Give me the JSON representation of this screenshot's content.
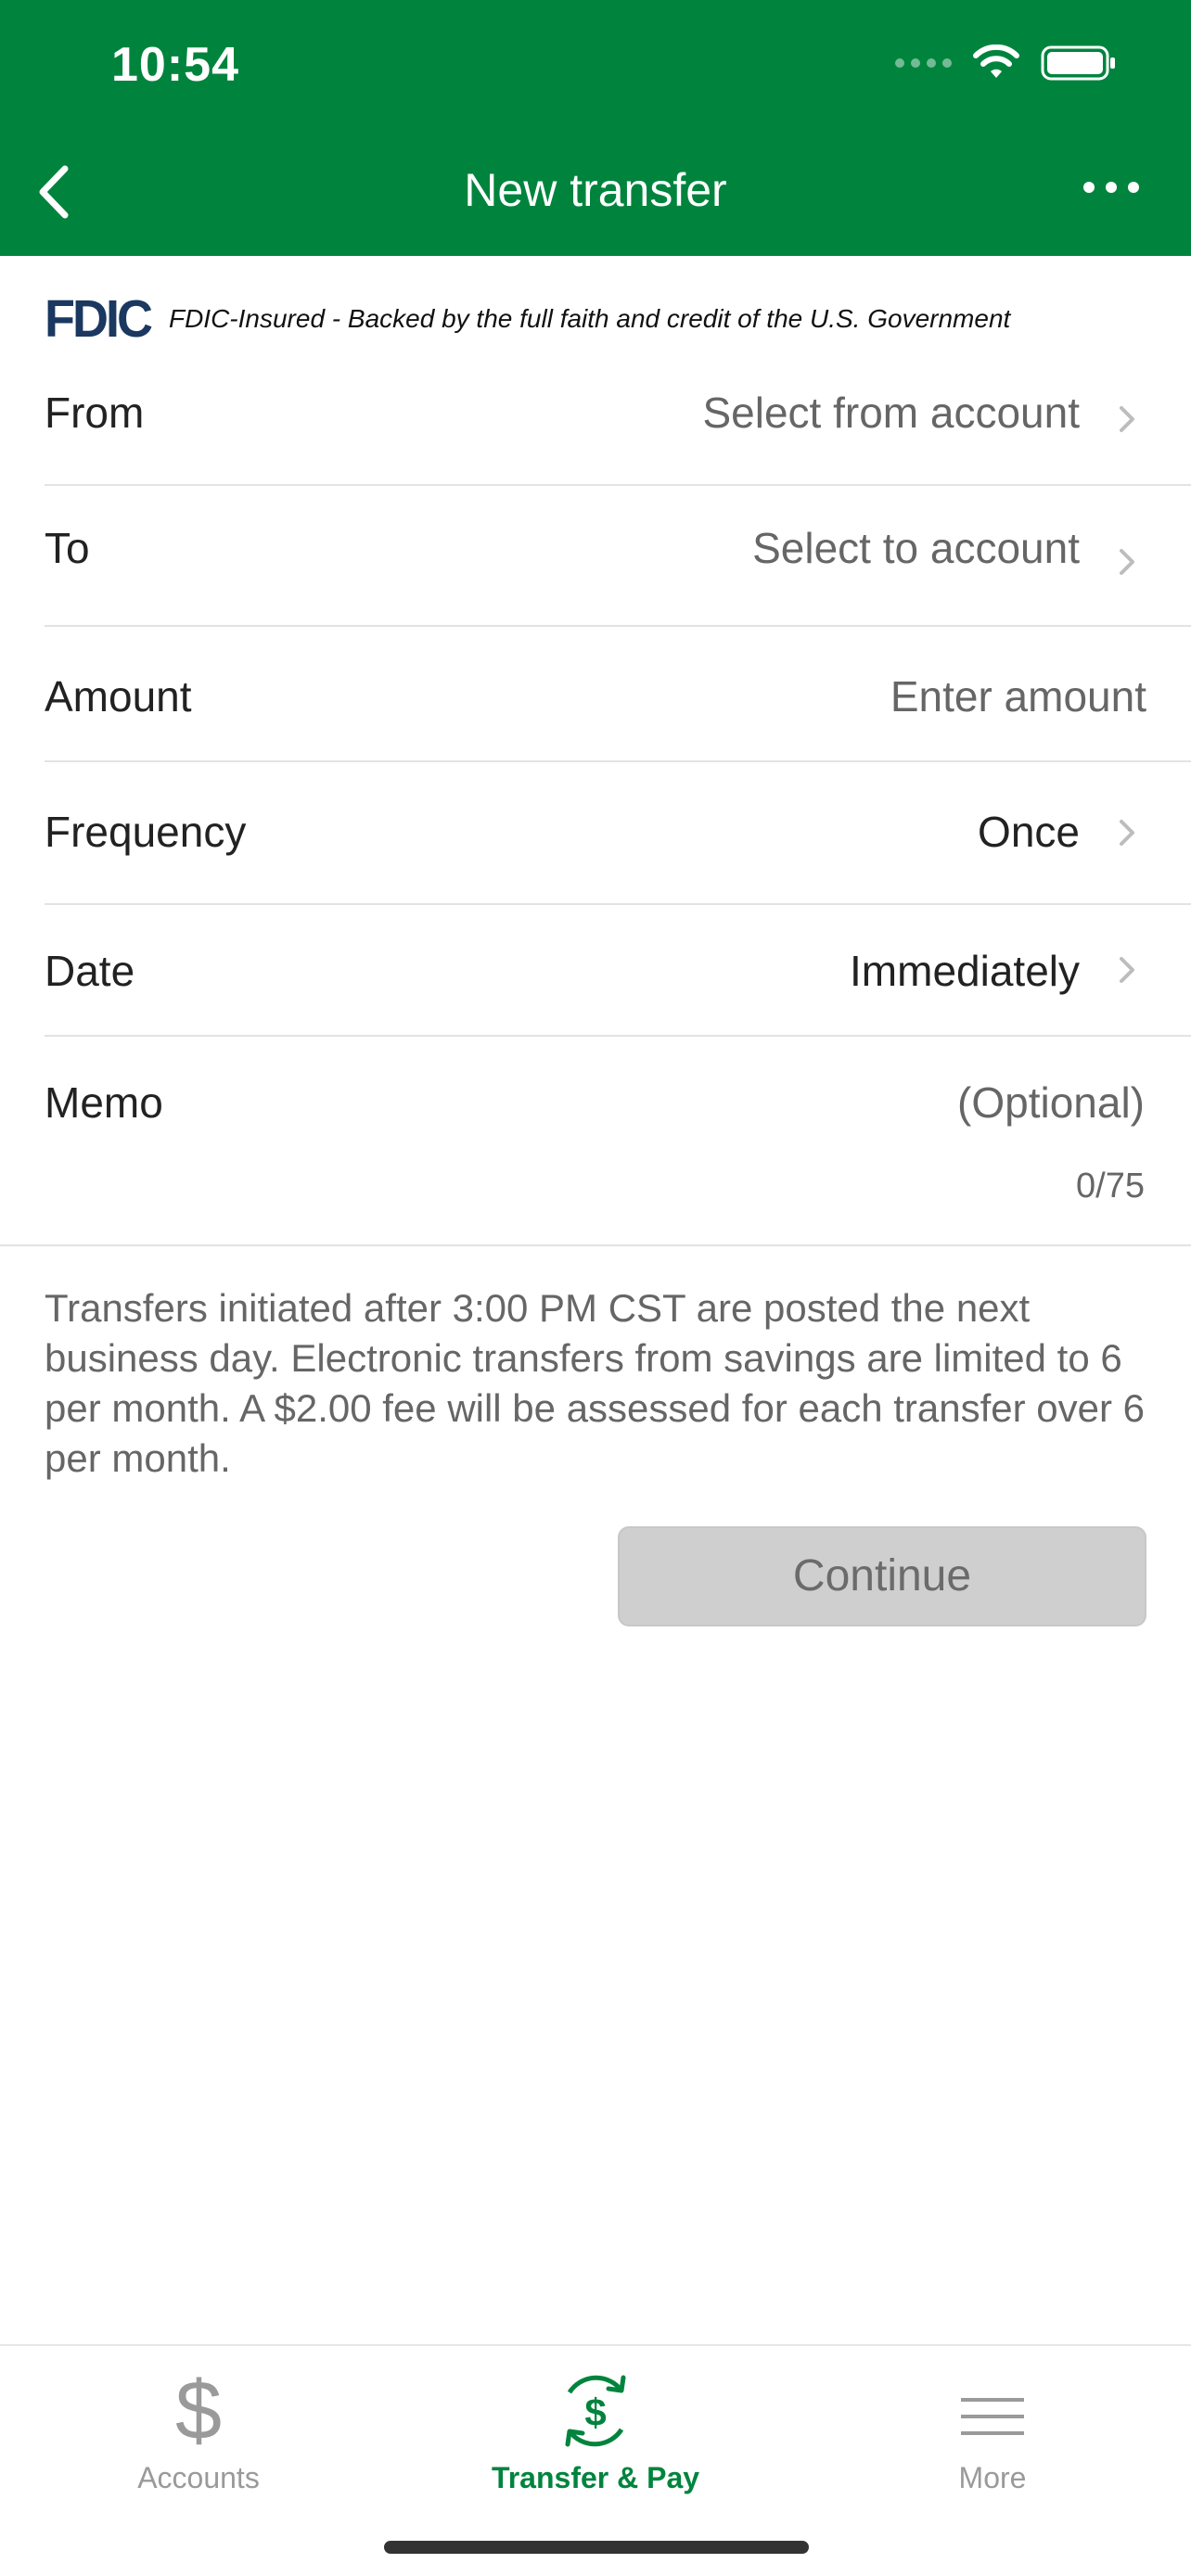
{
  "status_bar": {
    "time": "10:54"
  },
  "nav": {
    "title": "New transfer"
  },
  "fdic": {
    "logo_text": "FDIC",
    "tagline": "FDIC-Insured - Backed by the full faith and credit of the U.S. Government"
  },
  "form": {
    "from": {
      "label": "From",
      "value": "Select from account"
    },
    "to": {
      "label": "To",
      "value": "Select to account"
    },
    "amount": {
      "label": "Amount",
      "placeholder": "Enter amount"
    },
    "frequency": {
      "label": "Frequency",
      "value": "Once"
    },
    "date": {
      "label": "Date",
      "value": "Immediately"
    },
    "memo": {
      "label": "Memo",
      "placeholder": "(Optional)",
      "counter": "0/75"
    }
  },
  "notice": "Transfers initiated after 3:00 PM CST are posted the next business day. Electronic transfers from savings are limited to 6 per month. A $2.00 fee will be assessed for each transfer over 6 per month.",
  "continue_label": "Continue",
  "tabs": [
    {
      "label": "Accounts",
      "icon": "dollar-icon",
      "active": false
    },
    {
      "label": "Transfer & Pay",
      "icon": "transfer-pay-icon",
      "active": true
    },
    {
      "label": "More",
      "icon": "menu-icon",
      "active": false
    }
  ],
  "colors": {
    "brand_green": "#00843d",
    "fdic_blue": "#1a3860",
    "disabled_button": "#cfcfcf"
  }
}
